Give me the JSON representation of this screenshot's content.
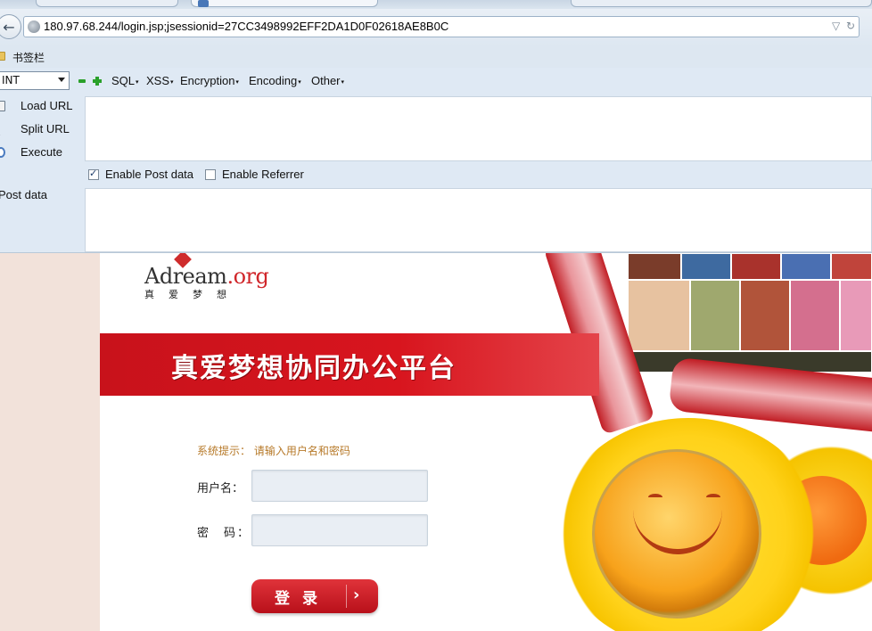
{
  "browser": {
    "url": "180.97.68.244/login.jsp;jsessionid=27CC3498992EFF2DA1D0F02618AE8B0C",
    "bookmarks_label": "书签栏"
  },
  "hackbar": {
    "select_value": "INT",
    "menus": [
      "SQL",
      "XSS",
      "Encryption",
      "Encoding",
      "Other"
    ],
    "commands": [
      "Load URL",
      "Split URL",
      "Execute"
    ],
    "enable_post_label": "Enable Post data",
    "enable_post_checked": true,
    "enable_referrer_label": "Enable Referrer",
    "enable_referrer_checked": false,
    "post_data_label": "Post data"
  },
  "page": {
    "logo_en": "Adream",
    "logo_org": ".org",
    "logo_cn": "真爱梦想",
    "banner_title": "真爱梦想协同办公平台",
    "hint": "系统提示： 请输入用户名和密码",
    "username_label": "用户名：",
    "password_label": "密　码：",
    "login_button": "登 录",
    "login_arrow": "›"
  },
  "colors": {
    "brand_red": "#c8121b",
    "hint_color": "#b77a2a"
  }
}
